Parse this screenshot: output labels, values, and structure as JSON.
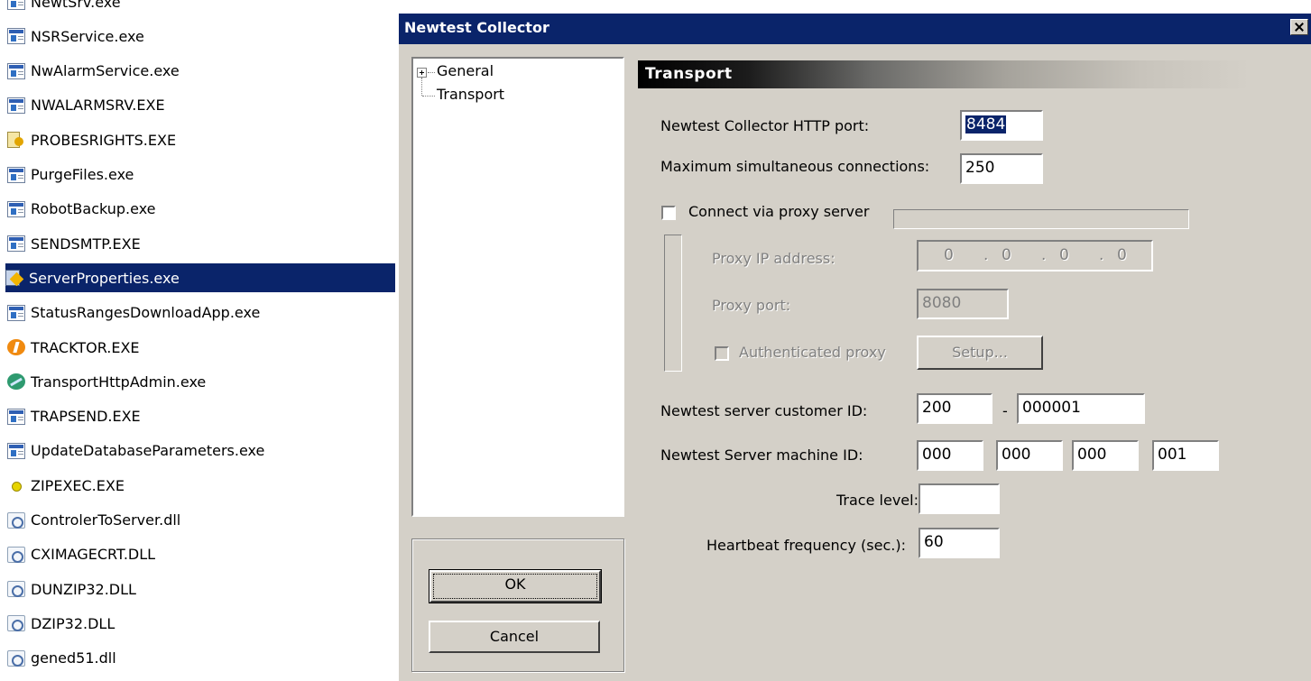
{
  "file_list": [
    {
      "name": "NewtSrv.exe",
      "icon": "exe-icon"
    },
    {
      "name": "NSRService.exe",
      "icon": "exe-icon"
    },
    {
      "name": "NwAlarmService.exe",
      "icon": "exe-icon"
    },
    {
      "name": "NWALARMSRV.EXE",
      "icon": "exe-icon"
    },
    {
      "name": "PROBESRIGHTS.EXE",
      "icon": "key-icon"
    },
    {
      "name": "PurgeFiles.exe",
      "icon": "exe-icon"
    },
    {
      "name": "RobotBackup.exe",
      "icon": "exe-icon"
    },
    {
      "name": "SENDSMTP.EXE",
      "icon": "exe-icon"
    },
    {
      "name": "ServerProperties.exe",
      "icon": "tool-icon",
      "selected": true
    },
    {
      "name": "StatusRangesDownloadApp.exe",
      "icon": "exe-icon"
    },
    {
      "name": "TRACKTOR.EXE",
      "icon": "orange-app-icon"
    },
    {
      "name": "TransportHttpAdmin.exe",
      "icon": "green-app-icon"
    },
    {
      "name": "TRAPSEND.EXE",
      "icon": "exe-icon"
    },
    {
      "name": "UpdateDatabaseParameters.exe",
      "icon": "exe-icon"
    },
    {
      "name": "ZIPEXEC.EXE",
      "icon": "yellow-dot-icon"
    },
    {
      "name": "ControlerToServer.dll",
      "icon": "dll-icon"
    },
    {
      "name": "CXIMAGECRT.DLL",
      "icon": "dll-icon"
    },
    {
      "name": "DUNZIP32.DLL",
      "icon": "dll-icon"
    },
    {
      "name": "DZIP32.DLL",
      "icon": "dll-icon"
    },
    {
      "name": "gened51.dll",
      "icon": "dll-icon"
    }
  ],
  "dialog": {
    "title": "Newtest Collector",
    "tree": {
      "general": "General",
      "transport": "Transport"
    },
    "buttons": {
      "ok": "OK",
      "cancel": "Cancel"
    },
    "section_title": "Transport",
    "http_port": {
      "label": "Newtest Collector HTTP port:",
      "value": "8484"
    },
    "max_connections": {
      "label": "Maximum simultaneous connections:",
      "value": "250"
    },
    "proxy": {
      "checkbox_label": "Connect via proxy server",
      "checked": false,
      "ip_label": "Proxy IP address:",
      "ip_octets": [
        "0",
        "0",
        "0",
        "0"
      ],
      "ip_separator": ".",
      "port_label": "Proxy port:",
      "port_value": "8080",
      "auth_label": "Authenticated proxy",
      "auth_checked": false,
      "setup_label": "Setup..."
    },
    "customer_id": {
      "label": "Newtest server customer ID:",
      "part1": "200",
      "separator": "-",
      "part2": "000001"
    },
    "machine_id": {
      "label": "Newtest Server machine ID:",
      "parts": [
        "000",
        "000",
        "000",
        "001"
      ]
    },
    "trace_level": {
      "label": "Trace level:",
      "value": ""
    },
    "heartbeat": {
      "label": "Heartbeat frequency (sec.):",
      "value": "60"
    }
  },
  "colors": {
    "selection": "#0a246a",
    "dialog_face": "#d4d0c8",
    "disabled_text": "#808080"
  }
}
